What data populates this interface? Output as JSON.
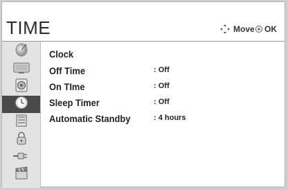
{
  "header": {
    "title": "TIME",
    "hints": [
      {
        "icon": "navigation-arrows-icon",
        "label": "Move"
      },
      {
        "icon": "ok-button-icon",
        "label": "OK"
      }
    ]
  },
  "sidebar": {
    "items": [
      {
        "icon": "satellite-dish-icon",
        "selected": false
      },
      {
        "icon": "tv-screen-icon",
        "selected": false
      },
      {
        "icon": "speaker-icon",
        "selected": false
      },
      {
        "icon": "clock-icon",
        "selected": true
      },
      {
        "icon": "lock-icon",
        "selected": false
      },
      {
        "icon": "padlock-icon",
        "selected": false
      },
      {
        "icon": "plug-cable-icon",
        "selected": false
      },
      {
        "icon": "clapperboard-icon",
        "selected": false
      }
    ]
  },
  "settings": [
    {
      "label": "Clock",
      "value": ""
    },
    {
      "label": "Off Time",
      "value": ": Off"
    },
    {
      "label": "On TIme",
      "value": ": Off"
    },
    {
      "label": "Sleep Timer",
      "value": ": Off"
    },
    {
      "label": "Automatic Standby",
      "value": ": 4 hours"
    }
  ],
  "colors": {
    "selected_background": "#4a4a4a",
    "sidebar_background": "#e3e3e3"
  }
}
